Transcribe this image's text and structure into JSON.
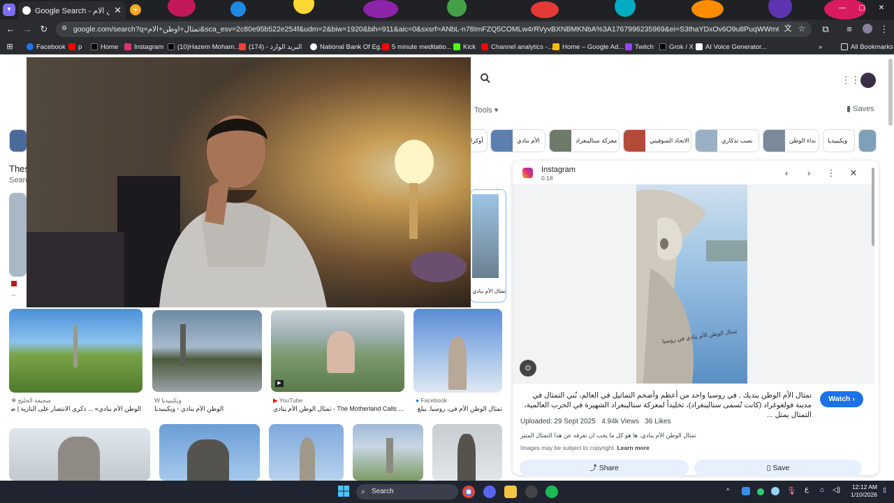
{
  "browser": {
    "tab_title": "Google Search - تمثال اوطن الام",
    "tab_close": "✕",
    "new_tab": "+",
    "url": "google.com/search?q=تمثال+اوطن+الام&sca_esv=2c80e95b522e254f&udm=2&biw=1920&bih=911&aic=0&sxsrf=ANbL-n78ImFZQ5COMLw4rRVyvBXNBMKNbA%3A1767996235969&ei=S3thaYDxOv6O9u8PuqWWmQQ&ved=0ahUKEwjAwu-c...",
    "bookmarks": [
      {
        "label": "Facebook",
        "color": "#1877f2"
      },
      {
        "label": "p",
        "color": "#ff0000"
      },
      {
        "label": "Home",
        "color": "#000000"
      },
      {
        "label": "Instagram",
        "color": "#e1306c"
      },
      {
        "label": "(10)Hazem Moham...",
        "color": "#000000"
      },
      {
        "label": "(174) - البريد الوارد",
        "color": "#ea4335"
      },
      {
        "label": "National Bank Of Eg...",
        "color": "#ffffff"
      },
      {
        "label": "5 minute meditatio...",
        "color": "#ff0000"
      },
      {
        "label": "Kick",
        "color": "#53fc18"
      },
      {
        "label": "Channel analytics -...",
        "color": "#ff0000"
      },
      {
        "label": "Home – Google Ad...",
        "color": "#fbbc04"
      },
      {
        "label": "Twitch",
        "color": "#9146ff"
      },
      {
        "label": "Grok / X",
        "color": "#000000"
      },
      {
        "label": "AI Voice Generator...",
        "color": "#ffffff"
      }
    ],
    "all_bookmarks": "All Bookmarks"
  },
  "google": {
    "tools": "Tools",
    "saves": "Saves",
    "chips": [
      "ويكيبيديا",
      "نداء الوطن",
      "نصب تذكاري",
      "الاتحاد السوفيتي",
      "معركة ستالينغراد",
      "الأم بتادي",
      "أوكرا"
    ],
    "heading": "Thes",
    "subheading": "Searc",
    "left_partial_caption": "تمثال الأم بنادي",
    "results_row2": [
      {
        "source": "صحيفة الخليج",
        "caption": "الوطن الأم ينادي» ... ذكرى الانتصار على النازية | صحيفة ..."
      },
      {
        "source": "ويكيبيديا",
        "caption": "الوطن الأم ينادي - ويكيبيديا"
      },
      {
        "source": "YouTube",
        "caption": "تمثال الوطن الأم ينادي - The Motherland Calls ..."
      },
      {
        "source": "Facebook",
        "caption": "تمثال الوطن الأم في، روسيا. يبلغ ارت..."
      }
    ]
  },
  "panel": {
    "source": "Instagram",
    "time": "0:18",
    "description": "تمثال الأم الوطن ينديك , في روسيا واحد من أعظم وأضخم التماثيل في العالم، بُني التمثال في مدينة فولغوغراد (كانت تُسمى ستالينغراد)، تخليداً لمعركة ستالينغراد الشهيرة في الحرب العالمية، التمثال يمثل ...",
    "watch": "Watch",
    "uploaded": "Uploaded: 29 Sept 2025",
    "views": "4.94k Views",
    "likes": "36 Likes",
    "subtitle": "تمثال الوطن الأم ينادي، ها هو كل ما يجب ان تعرفه عن هذا التمثال المثير",
    "copyright": "Images may be subject to copyright.",
    "learn_more": "Learn more",
    "share": "Share",
    "save": "Save",
    "video_overlay_text": "تمثال الوطن الأم ينادي في روسيا"
  },
  "taskbar": {
    "search": "Search",
    "time": "12:12 AM",
    "date": "1/10/2026",
    "lang": "ع"
  }
}
